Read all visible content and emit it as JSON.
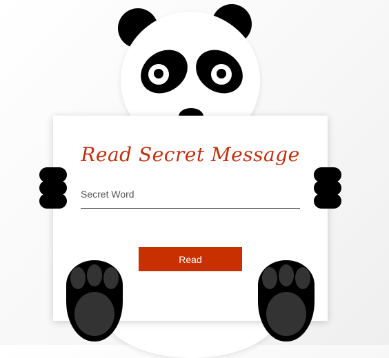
{
  "form": {
    "title": "Read Secret Message",
    "secret_word_label": "Secret Word",
    "secret_word_value": "",
    "read_button_label": "Read"
  },
  "colors": {
    "title": "#c0300f",
    "button": "#c93000",
    "panda": "#000000"
  }
}
